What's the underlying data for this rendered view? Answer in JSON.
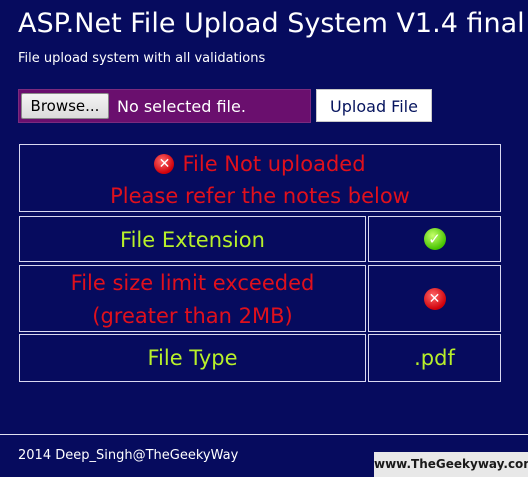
{
  "header": {
    "title": "ASP.Net File Upload System V1.4 final",
    "subtitle": "File upload system with all validations"
  },
  "upload": {
    "browse_label": "Browse...",
    "file_status": "No selected file.",
    "upload_label": "Upload File"
  },
  "message": {
    "line1": "File Not uploaded",
    "line2": "Please refer the notes below",
    "icon": "error-icon"
  },
  "rows": [
    {
      "label": "File Extension",
      "status": "ok",
      "icon": "check-icon"
    },
    {
      "label_line1": "File size limit exceeded",
      "label_line2": "(greater than 2MB)",
      "status": "error",
      "icon": "error-icon"
    },
    {
      "label": "File Type",
      "value": ".pdf"
    }
  ],
  "footer": {
    "copyright": "2014 Deep_Singh@TheGeekyWay",
    "watermark": "www.TheGeekyway.com"
  },
  "colors": {
    "background": "#060b5e",
    "error_text": "#e0101c",
    "ok_text": "#b8f02a",
    "file_picker_bg": "#6a0f6e"
  }
}
